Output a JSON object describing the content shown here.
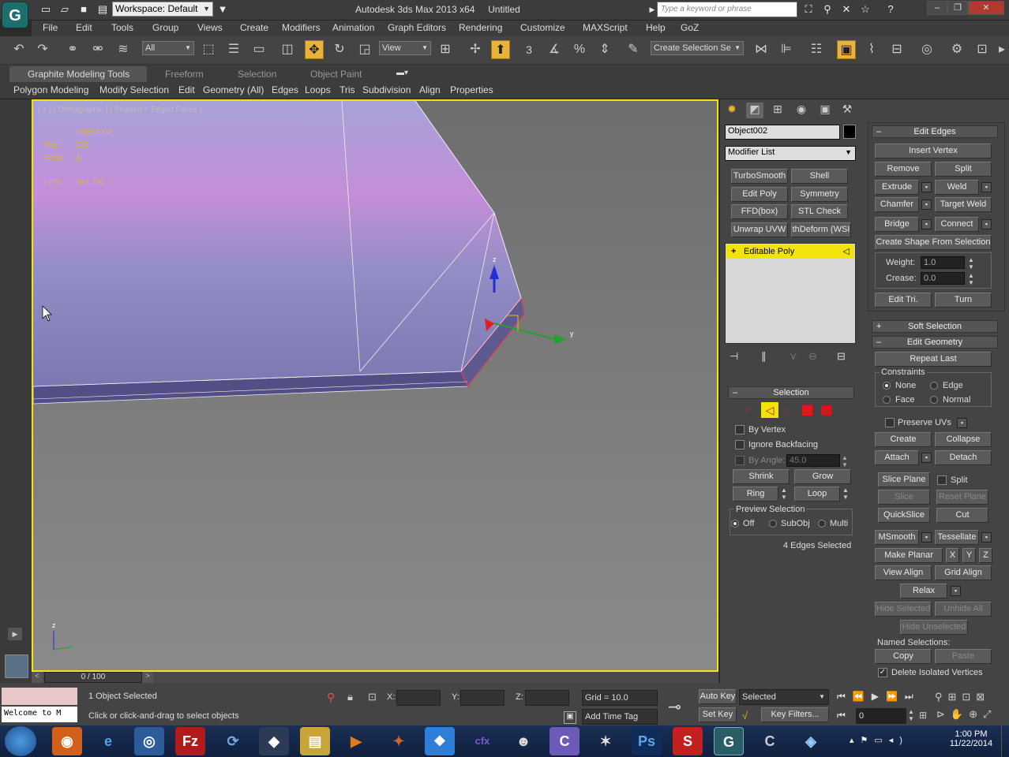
{
  "titlebar": {
    "workspace": "Workspace: Default",
    "title": "Autodesk 3ds Max  2013 x64",
    "doc": "Untitled",
    "search_placeholder": "Type a keyword or phrase"
  },
  "menus": [
    "File",
    "Edit",
    "Tools",
    "Group",
    "Views",
    "Create",
    "Modifiers",
    "Animation",
    "Graph Editors",
    "Rendering",
    "Customize",
    "MAXScript",
    "Help",
    "GoZ"
  ],
  "toolbar": {
    "filter": "All",
    "ref_coord": "View",
    "selection_set": "Create Selection Se",
    "snap_number": "3"
  },
  "ribbon": {
    "tabs": [
      "Graphite Modeling Tools",
      "Freeform",
      "Selection",
      "Object Paint"
    ],
    "submenus": [
      "Polygon Modeling",
      "Modify Selection",
      "Edit",
      "Geometry (All)",
      "Edges",
      "Loops",
      "Tris",
      "Subdivision",
      "Align",
      "Properties"
    ]
  },
  "viewport": {
    "label": "[ + ] [ Orthographic ] [ Shaded + Edged Faces ]",
    "object": "Object002",
    "tris_label": "Tris:",
    "tris": "128",
    "verts_label": "Verts:",
    "verts": "1",
    "fps_label": "FPS:",
    "fps": "682.780",
    "axis_z": "z",
    "axis_y": "y",
    "mini_z": "z"
  },
  "panel": {
    "object_name": "Object002",
    "object_color": "#000000",
    "modifier_list": "Modifier List",
    "modifier_buttons": [
      "TurboSmooth",
      "Shell",
      "Edit Poly",
      "Symmetry",
      "FFD(box)",
      "STL Check",
      "Unwrap UVW",
      "thDeform (WSI"
    ],
    "stack_item": "Editable Poly",
    "selection": {
      "title": "Selection",
      "by_vertex": "By Vertex",
      "ignore_backfacing": "Ignore Backfacing",
      "by_angle": "By Angle:",
      "angle": "45.0",
      "shrink": "Shrink",
      "grow": "Grow",
      "ring": "Ring",
      "loop": "Loop",
      "preview": "Preview Selection",
      "off": "Off",
      "subobj": "SubObj",
      "multi": "Multi",
      "status": "4 Edges Selected"
    },
    "edit_edges": {
      "title": "Edit Edges",
      "insert_vertex": "Insert Vertex",
      "remove": "Remove",
      "split": "Split",
      "extrude": "Extrude",
      "weld": "Weld",
      "chamfer": "Chamfer",
      "target_weld": "Target Weld",
      "bridge": "Bridge",
      "connect": "Connect",
      "create_shape": "Create Shape From Selection",
      "weight_label": "Weight:",
      "weight": "1.0",
      "crease_label": "Crease:",
      "crease": "0.0",
      "edit_tri": "Edit Tri.",
      "turn": "Turn"
    },
    "soft_selection": "Soft Selection",
    "edit_geometry": {
      "title": "Edit Geometry",
      "repeat_last": "Repeat Last",
      "constraints": "Constraints",
      "none": "None",
      "edge": "Edge",
      "face": "Face",
      "normal": "Normal",
      "preserve_uvs": "Preserve UVs",
      "create": "Create",
      "collapse": "Collapse",
      "attach": "Attach",
      "detach": "Detach",
      "slice_plane": "Slice Plane",
      "split": "Split",
      "slice": "Slice",
      "reset_plane": "Reset Plane",
      "quickslice": "QuickSlice",
      "cut": "Cut",
      "msmooth": "MSmooth",
      "tessellate": "Tessellate",
      "make_planar": "Make Planar",
      "x": "X",
      "y": "Y",
      "z": "Z",
      "view_align": "View Align",
      "grid_align": "Grid Align",
      "relax": "Relax",
      "hide_selected": "Hide Selected",
      "unhide_all": "Unhide All",
      "hide_unselected": "Hide Unselected",
      "named_selections": "Named Selections:",
      "copy": "Copy",
      "paste": "Paste",
      "delete_isolated": "Delete Isolated Vertices"
    }
  },
  "timeline": {
    "frame": "0 / 100"
  },
  "status": {
    "selected": "1 Object Selected",
    "prompt": "Click or click-and-drag to select objects",
    "x_label": "X:",
    "y_label": "Y:",
    "z_label": "Z:",
    "grid": "Grid = 10.0",
    "add_time_tag": "Add Time Tag",
    "auto_key": "Auto Key",
    "set_key": "Set Key",
    "selected_dd": "Selected",
    "key_filters": "Key Filters...",
    "frame_field": "0",
    "welcome": "Welcome to M"
  },
  "taskbar": {
    "time": "1:00 PM",
    "date": "11/22/2014"
  }
}
